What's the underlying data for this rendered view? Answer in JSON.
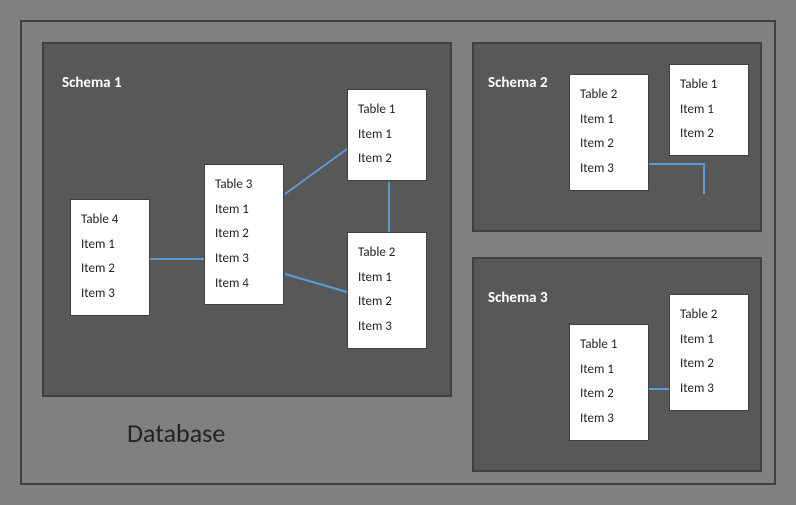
{
  "db_label": "Database",
  "schemas": [
    {
      "title": "Schema 1",
      "tables": [
        {
          "name": "Table 4",
          "items": [
            "Item 1",
            "Item 2",
            "Item 3"
          ]
        },
        {
          "name": "Table 3",
          "items": [
            "Item 1",
            "Item 2",
            "Item 3",
            "Item 4"
          ]
        },
        {
          "name": "Table 1",
          "items": [
            "Item 1",
            "Item 2"
          ]
        },
        {
          "name": "Table 2",
          "items": [
            "Item 1",
            "Item 2",
            "Item 3"
          ]
        }
      ]
    },
    {
      "title": "Schema 2",
      "tables": [
        {
          "name": "Table 2",
          "items": [
            "Item 1",
            "Item 2",
            "Item 3"
          ]
        },
        {
          "name": "Table 1",
          "items": [
            "Item 1",
            "Item 2"
          ]
        }
      ]
    },
    {
      "title": "Schema 3",
      "tables": [
        {
          "name": "Table 1",
          "items": [
            "Item 1",
            "Item 2",
            "Item 3"
          ]
        },
        {
          "name": "Table 2",
          "items": [
            "Item 1",
            "Item 2",
            "Item 3"
          ]
        }
      ]
    }
  ]
}
